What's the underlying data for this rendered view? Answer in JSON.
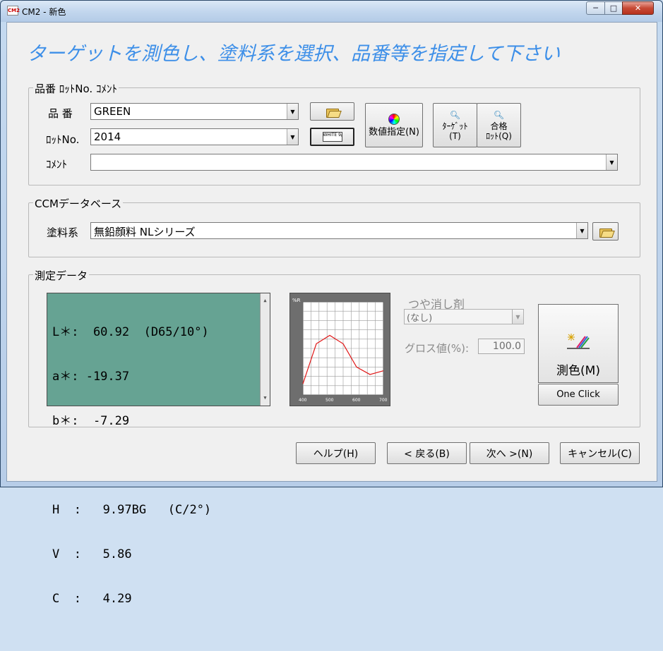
{
  "window": {
    "title": "CM2 - 新色",
    "icon_text": "CM2",
    "caption_buttons": {
      "minimize": "─",
      "maximize": "□",
      "close": "✕"
    }
  },
  "heading": "ターゲットを測色し、塗料系を選択、品番等を指定して下さい",
  "product_group": {
    "legend": "品番  ﾛｯﾄNo.  ｺﾒﾝﾄ",
    "hinban_label": "品 番",
    "hinban_value": "GREEN",
    "lot_label": "ﾛｯﾄNo.",
    "lot_value": "2014",
    "comment_label": "ｺﾒﾝﾄ",
    "comment_value": "",
    "open_icon": "folder-open-icon",
    "spec_icon": "spec-card-icon",
    "spec_icon_text": "WHITE 9/20",
    "numeric_button": "数値指定(N)",
    "target_button_line1": "ﾀｰｹﾞｯﾄ",
    "target_button_line2": "(T)",
    "pass_button_line1": "合格",
    "pass_button_line2": "ﾛｯﾄ(Q)"
  },
  "ccm_group": {
    "legend": "CCMデータベース",
    "paint_label": "塗料系",
    "paint_value": "無鉛顔料 NLシリーズ"
  },
  "measure_group": {
    "legend": "測定データ",
    "data_lines": [
      "L＊:  60.92  (D65/10°)",
      "a＊: -19.37",
      "b＊:  -7.29",
      "",
      "H  :   9.97BG   (C/2°)",
      "V  :   5.86",
      "C  :   4.29"
    ],
    "graph_ylabel": "%R",
    "graph_xticks": [
      "400",
      "500",
      "600",
      "700"
    ],
    "matte_label": "つや消し剤",
    "matte_value": "(なし)",
    "gloss_label": "グロス値(%):",
    "gloss_value": "100.0",
    "measure_button": "測色(M)",
    "oneclick_button": "One Click"
  },
  "footer": {
    "help": "ヘルプ(H)",
    "back": "< 戻る(B)",
    "next": "次へ >(N)",
    "cancel": "キャンセル(C)"
  },
  "chart_data": {
    "type": "line",
    "x": [
      400,
      450,
      500,
      550,
      600,
      650,
      700
    ],
    "series": [
      {
        "values": [
          12,
          55,
          64,
          55,
          30,
          22,
          26
        ]
      }
    ],
    "xlim": [
      400,
      700
    ],
    "ylim": [
      0,
      100
    ],
    "grid": true,
    "color": "#e01818"
  }
}
